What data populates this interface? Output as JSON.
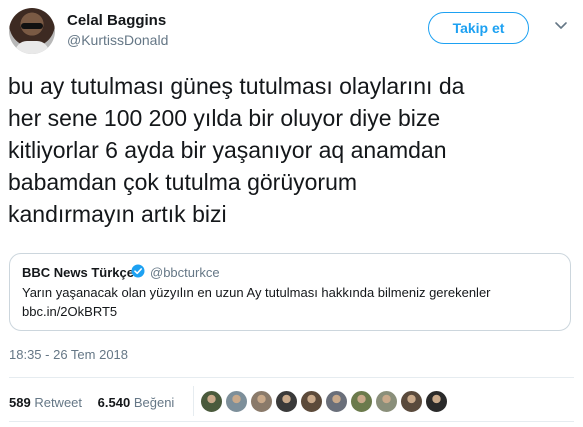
{
  "author": {
    "name": "Celal Baggins",
    "handle": "@KurtissDonald",
    "avatar_icon": "profile-avatar"
  },
  "follow_button": {
    "label": "Takip et"
  },
  "menu_icon": "chevron-down-icon",
  "tweet": {
    "text": "bu ay tutulması güneş tutulması olaylarını da\nher sene 100 200 yılda bir oluyor diye bize\nkitliyorlar 6 ayda bir yaşanıyor aq anamdan\nbabamdan çok tutulma görüyorum\nkandırmayın artık bizi"
  },
  "quoted": {
    "name": "BBC News Türkçe",
    "handle": "@bbcturkce",
    "text": "Yarın yaşanacak olan yüzyılın en uzun Ay tutulması hakkında bilmeniz gerekenler",
    "link": "bbc.in/2OkBRT5"
  },
  "timestamp": "18:35 - 26 Tem 2018",
  "stats": {
    "retweets_count": "589",
    "retweets_label": "Retweet",
    "likes_count": "6.540",
    "likes_label": "Beğeni"
  },
  "likers": [
    {
      "color": "#4a5a3c"
    },
    {
      "color": "#7d8f9a"
    },
    {
      "color": "#8a7a6a"
    },
    {
      "color": "#3a3a3a"
    },
    {
      "color": "#5c4a3a"
    },
    {
      "color": "#6a6f7a"
    },
    {
      "color": "#6b7a4c"
    },
    {
      "color": "#8a8f7a"
    },
    {
      "color": "#5a4a3c"
    },
    {
      "color": "#2a2a2a"
    }
  ],
  "colors": {
    "accent": "#1da1f2",
    "text": "#14171a",
    "muted": "#657786",
    "border": "#ccd6dd"
  }
}
